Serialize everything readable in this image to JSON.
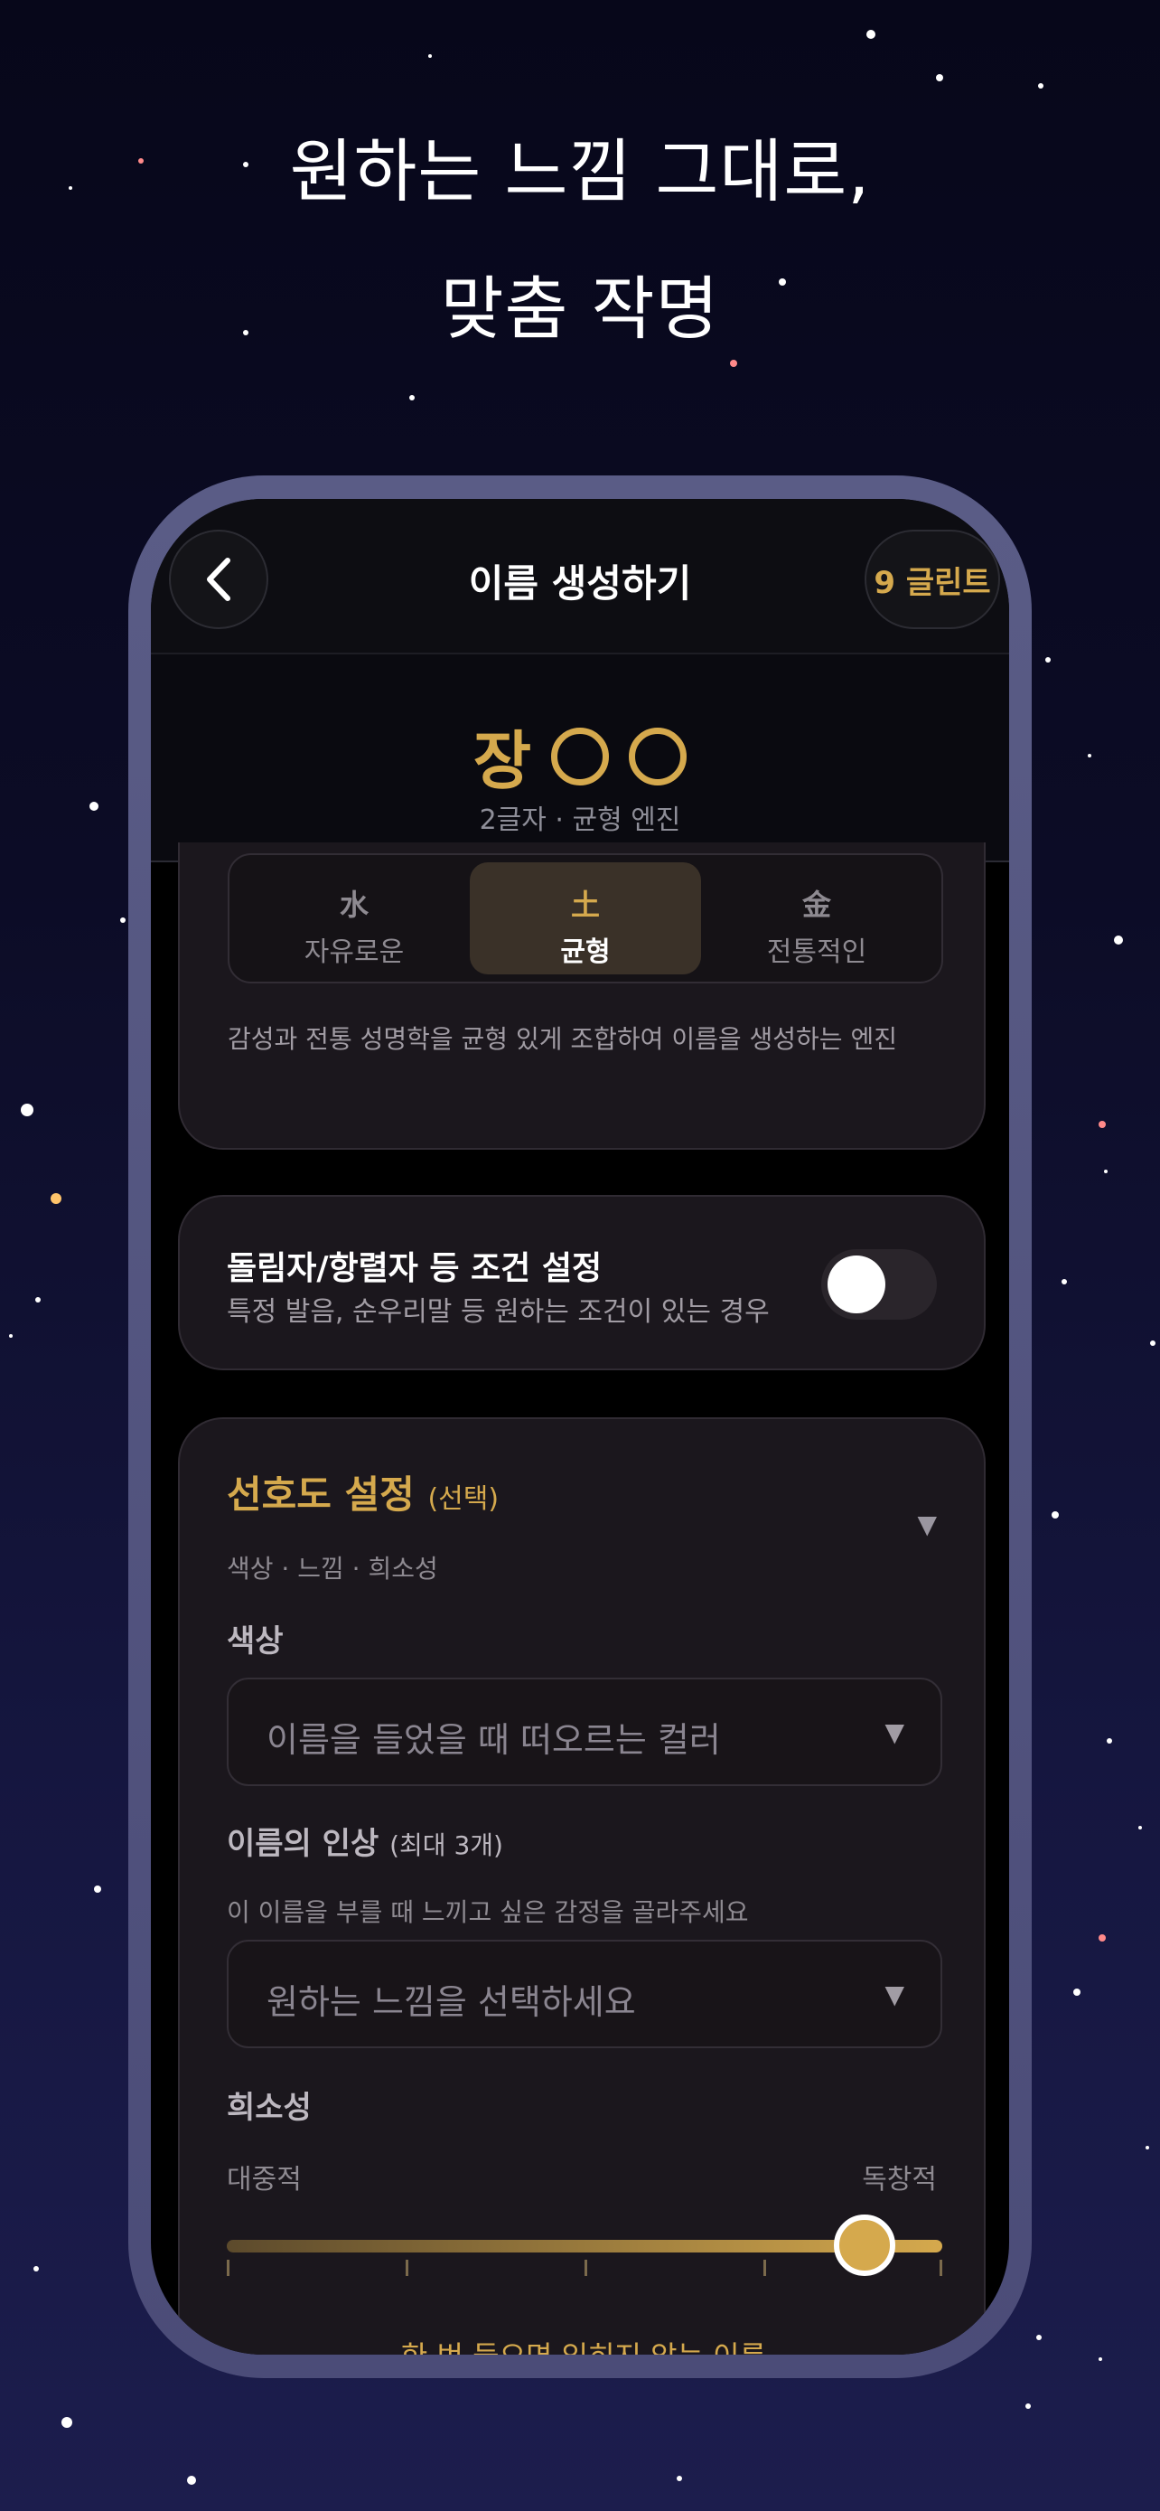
{
  "headline": {
    "line1": "원하는 느낌 그대로,",
    "line2": "맞춤 작명"
  },
  "app_bar": {
    "title": "이름 생성하기",
    "credits": "9 글린트",
    "back_icon": "chevron-left-icon"
  },
  "name_preview": {
    "surname": "장",
    "placeholder_count": 2,
    "info": "2글자 · 균형 엔진"
  },
  "engine_tabs": [
    {
      "hanja": "水",
      "label": "자유로운",
      "selected": false
    },
    {
      "hanja": "土",
      "label": "균형",
      "selected": true
    },
    {
      "hanja": "金",
      "label": "전통적인",
      "selected": false
    }
  ],
  "engine_description": "감성과 전통 성명학을 균형 있게 조합하여 이름을 생성하는 엔진",
  "condition": {
    "title": "돌림자/항렬자 등 조건 설정",
    "description": "특정 발음, 순우리말 등 원하는 조건이 있는 경우",
    "enabled": false
  },
  "preferences": {
    "title": "선호도 설정",
    "optional": "(선택)",
    "subtitle": "색상 · 느낌 · 희소성",
    "color": {
      "label": "색상",
      "placeholder": "이름을 들었을 때 떠오르는 컬러"
    },
    "impression": {
      "label": "이름의 인상",
      "limit": "(최대 3개)",
      "hint": "이 이름을 부를 때 느끼고 싶은 감정을 골라주세요",
      "placeholder": "원하는 느낌을 선택하세요"
    },
    "rarity": {
      "label": "희소성",
      "min_label": "대중적",
      "max_label": "독창적",
      "value": 0.9,
      "description": "한 번 들으면 잊히지 않는 이름"
    }
  },
  "colors": {
    "accent": "#d5a94d",
    "card": "#1b171d",
    "background": "#0c0c26"
  }
}
